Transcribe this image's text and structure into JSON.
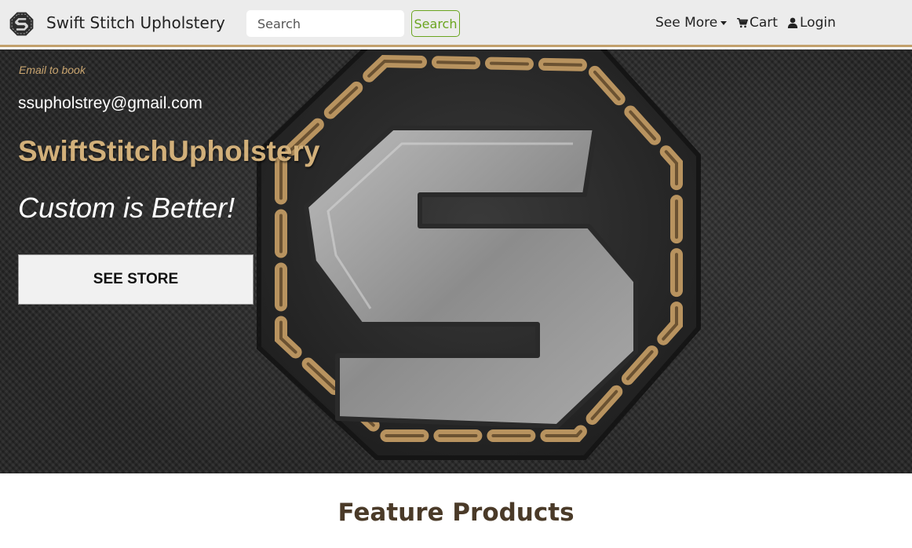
{
  "navbar": {
    "brand_name": "Swift Stitch Upholstery",
    "search_placeholder": "Search",
    "search_button_label": "Search",
    "see_more_label": "See More",
    "cart_label": "Cart",
    "login_label": "Login",
    "icons": {
      "logo": "s-hexagon-logo-icon",
      "cart": "cart-icon",
      "login": "user-icon",
      "dropdown": "caret-down-icon"
    }
  },
  "hero": {
    "email_label": "Email to book",
    "email_address": "ssupholstrey@gmail.com",
    "title": "SwiftStitchUpholstery",
    "tagline": "Custom is Better!",
    "cta_label": "SEE STORE"
  },
  "feature": {
    "heading": "Feature Products"
  },
  "colors": {
    "accent_gold": "#c2a06c",
    "search_button_green": "#6aa51f",
    "navbar_bg": "#ececec",
    "hero_bg": "#2c2c2c"
  }
}
